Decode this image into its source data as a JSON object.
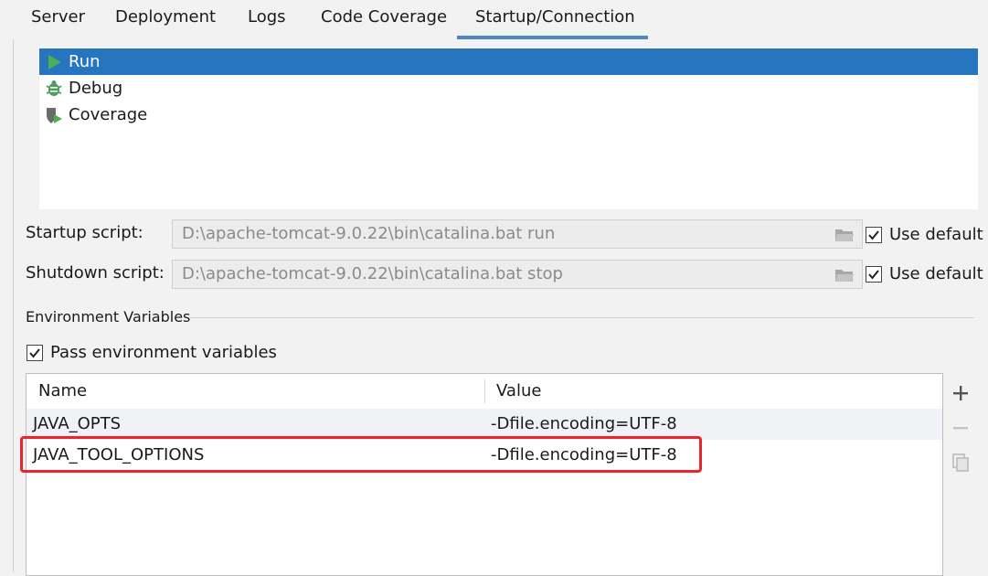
{
  "tabs": [
    {
      "label": "Server"
    },
    {
      "label": "Deployment"
    },
    {
      "label": "Logs"
    },
    {
      "label": "Code Coverage"
    },
    {
      "label": "Startup/Connection",
      "active": true
    }
  ],
  "executors": [
    {
      "label": "Run",
      "icon": "run-triangle-icon",
      "selected": true
    },
    {
      "label": "Debug",
      "icon": "bug-icon"
    },
    {
      "label": "Coverage",
      "icon": "coverage-shield-icon"
    }
  ],
  "startup": {
    "label": "Startup script:",
    "value": "D:\\apache-tomcat-9.0.22\\bin\\catalina.bat run",
    "use_default_label": "Use default",
    "use_default_checked": true
  },
  "shutdown": {
    "label": "Shutdown script:",
    "value": "D:\\apache-tomcat-9.0.22\\bin\\catalina.bat stop",
    "use_default_label": "Use default",
    "use_default_checked": true
  },
  "env": {
    "group_title": "Environment Variables",
    "pass_label": "Pass environment variables",
    "pass_checked": true,
    "columns": [
      "Name",
      "Value"
    ],
    "rows": [
      {
        "name": "JAVA_OPTS",
        "value": "-Dfile.encoding=UTF-8"
      },
      {
        "name": "JAVA_TOOL_OPTIONS",
        "value": "-Dfile.encoding=UTF-8"
      }
    ]
  },
  "colors": {
    "selection": "#2675bf",
    "tab_underline": "#4a88c7",
    "highlight": "#e8262e",
    "run_green": "#4caf50"
  },
  "toolbar_icons": [
    "add-icon",
    "remove-icon",
    "copy-icon"
  ]
}
